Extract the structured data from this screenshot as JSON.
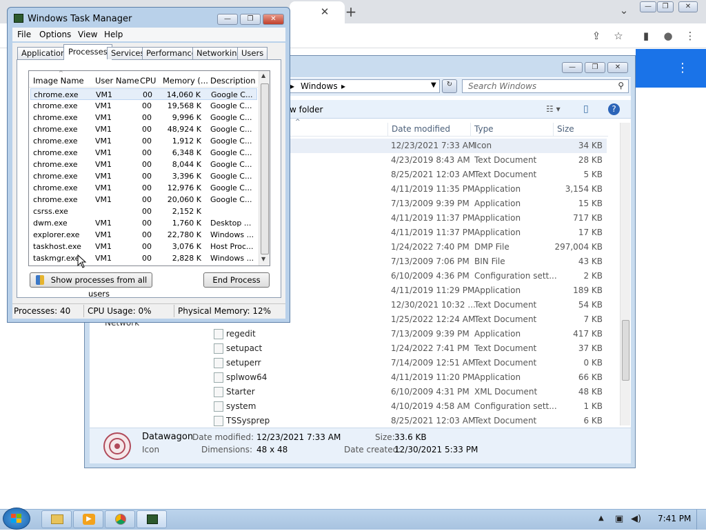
{
  "browser": {
    "new_tab": "+",
    "tab_close": "✕",
    "tab_dropdown": "⌄",
    "win_min": "—",
    "win_max": "❐",
    "win_close": "✕",
    "share": "⇪",
    "bookmark": "☆",
    "sidebar": "▮",
    "profile": "●",
    "menu": "⋮",
    "page_menu": "⋮"
  },
  "explorer": {
    "address_segment": "Windows",
    "search_placeholder": "Search Windows",
    "new_folder": "w folder",
    "columns": {
      "date": "Date modified",
      "type": "Type",
      "size": "Size"
    },
    "sidebar_item": "Network",
    "files": [
      {
        "name": "",
        "date": "12/23/2021 7:33 AM",
        "type": "Icon",
        "size": "34 KB"
      },
      {
        "name": "",
        "date": "4/23/2019 8:43 AM",
        "type": "Text Document",
        "size": "28 KB"
      },
      {
        "name": "",
        "date": "8/25/2021 12:03 AM",
        "type": "Text Document",
        "size": "5 KB"
      },
      {
        "name": "",
        "date": "4/11/2019 11:35 PM",
        "type": "Application",
        "size": "3,154 KB"
      },
      {
        "name": "",
        "date": "7/13/2009 9:39 PM",
        "type": "Application",
        "size": "15 KB"
      },
      {
        "name": "",
        "date": "4/11/2019 11:37 PM",
        "type": "Application",
        "size": "717 KB"
      },
      {
        "name": "",
        "date": "4/11/2019 11:37 PM",
        "type": "Application",
        "size": "17 KB"
      },
      {
        "name": "",
        "date": "1/24/2022 7:40 PM",
        "type": "DMP File",
        "size": "297,004 KB"
      },
      {
        "name": "",
        "date": "7/13/2009 7:06 PM",
        "type": "BIN File",
        "size": "43 KB"
      },
      {
        "name": "",
        "date": "6/10/2009 4:36 PM",
        "type": "Configuration sett...",
        "size": "2 KB"
      },
      {
        "name": "",
        "date": "4/11/2019 11:29 PM",
        "type": "Application",
        "size": "189 KB"
      },
      {
        "name": "",
        "date": "12/30/2021 10:32 ...",
        "type": "Text Document",
        "size": "54 KB"
      },
      {
        "name": "",
        "date": "1/25/2022 12:24 AM",
        "type": "Text Document",
        "size": "7 KB"
      },
      {
        "name": "regedit",
        "date": "7/13/2009 9:39 PM",
        "type": "Application",
        "size": "417 KB"
      },
      {
        "name": "setupact",
        "date": "1/24/2022 7:41 PM",
        "type": "Text Document",
        "size": "37 KB"
      },
      {
        "name": "setuperr",
        "date": "7/14/2009 12:51 AM",
        "type": "Text Document",
        "size": "0 KB"
      },
      {
        "name": "splwow64",
        "date": "4/11/2019 11:20 PM",
        "type": "Application",
        "size": "66 KB"
      },
      {
        "name": "Starter",
        "date": "6/10/2009 4:31 PM",
        "type": "XML Document",
        "size": "48 KB"
      },
      {
        "name": "system",
        "date": "4/10/2019 4:58 AM",
        "type": "Configuration sett...",
        "size": "1 KB"
      },
      {
        "name": "TSSysprep",
        "date": "8/25/2021 12:03 AM",
        "type": "Text Document",
        "size": "6 KB"
      }
    ],
    "details": {
      "name": "Datawagon",
      "type": "Icon",
      "modified_label": "Date modified:",
      "modified": "12/23/2021 7:33 AM",
      "dimensions_label": "Dimensions:",
      "dimensions": "48 x 48",
      "size_label": "Size:",
      "size": "33.6 KB",
      "created_label": "Date created:",
      "created": "12/30/2021 5:33 PM"
    }
  },
  "taskmgr": {
    "title": "Windows Task Manager",
    "menu": [
      "File",
      "Options",
      "View",
      "Help"
    ],
    "tabs": [
      "Applications",
      "Processes",
      "Services",
      "Performance",
      "Networking",
      "Users"
    ],
    "active_tab": "Processes",
    "columns": [
      "Image Name",
      "User Name",
      "CPU",
      "Memory (...",
      "Description"
    ],
    "processes": [
      {
        "image": "chrome.exe",
        "user": "VM1",
        "cpu": "00",
        "mem": "14,060 K",
        "desc": "Google C..."
      },
      {
        "image": "chrome.exe",
        "user": "VM1",
        "cpu": "00",
        "mem": "19,568 K",
        "desc": "Google C..."
      },
      {
        "image": "chrome.exe",
        "user": "VM1",
        "cpu": "00",
        "mem": "9,996 K",
        "desc": "Google C..."
      },
      {
        "image": "chrome.exe",
        "user": "VM1",
        "cpu": "00",
        "mem": "48,924 K",
        "desc": "Google C..."
      },
      {
        "image": "chrome.exe",
        "user": "VM1",
        "cpu": "00",
        "mem": "1,912 K",
        "desc": "Google C..."
      },
      {
        "image": "chrome.exe",
        "user": "VM1",
        "cpu": "00",
        "mem": "6,348 K",
        "desc": "Google C..."
      },
      {
        "image": "chrome.exe",
        "user": "VM1",
        "cpu": "00",
        "mem": "8,044 K",
        "desc": "Google C..."
      },
      {
        "image": "chrome.exe",
        "user": "VM1",
        "cpu": "00",
        "mem": "3,396 K",
        "desc": "Google C..."
      },
      {
        "image": "chrome.exe",
        "user": "VM1",
        "cpu": "00",
        "mem": "12,976 K",
        "desc": "Google C..."
      },
      {
        "image": "chrome.exe",
        "user": "VM1",
        "cpu": "00",
        "mem": "20,060 K",
        "desc": "Google C..."
      },
      {
        "image": "csrss.exe",
        "user": "",
        "cpu": "00",
        "mem": "2,152 K",
        "desc": ""
      },
      {
        "image": "dwm.exe",
        "user": "VM1",
        "cpu": "00",
        "mem": "1,760 K",
        "desc": "Desktop ..."
      },
      {
        "image": "explorer.exe",
        "user": "VM1",
        "cpu": "00",
        "mem": "22,780 K",
        "desc": "Windows ..."
      },
      {
        "image": "taskhost.exe",
        "user": "VM1",
        "cpu": "00",
        "mem": "3,076 K",
        "desc": "Host Proc..."
      },
      {
        "image": "taskmgr.exe",
        "user": "VM1",
        "cpu": "00",
        "mem": "2,828 K",
        "desc": "Windows ..."
      }
    ],
    "show_all_button": "Show processes from all users",
    "end_process_button": "End Process",
    "status": {
      "processes": "Processes: 40",
      "cpu": "CPU Usage: 0%",
      "memory": "Physical Memory: 12%"
    }
  },
  "taskbar": {
    "clock": "7:41 PM"
  }
}
